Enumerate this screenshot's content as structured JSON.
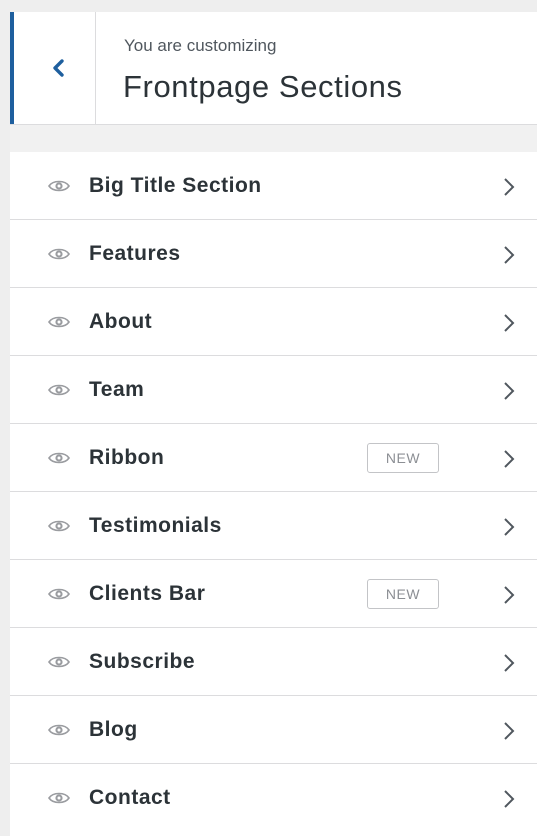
{
  "header": {
    "subtitle": "You are customizing",
    "title": "Frontpage Sections",
    "back_icon": "chevron-left-icon",
    "accent": "#1e5f9e"
  },
  "sections": [
    {
      "label": "Big Title Section",
      "badge": ""
    },
    {
      "label": "Features",
      "badge": ""
    },
    {
      "label": "About",
      "badge": ""
    },
    {
      "label": "Team",
      "badge": ""
    },
    {
      "label": "Ribbon",
      "badge": "NEW"
    },
    {
      "label": "Testimonials",
      "badge": ""
    },
    {
      "label": "Clients Bar",
      "badge": "NEW"
    },
    {
      "label": "Subscribe",
      "badge": ""
    },
    {
      "label": "Blog",
      "badge": ""
    },
    {
      "label": "Contact",
      "badge": ""
    }
  ],
  "icons": {
    "visibility": "eye-icon",
    "navigate": "chevron-right-icon"
  }
}
